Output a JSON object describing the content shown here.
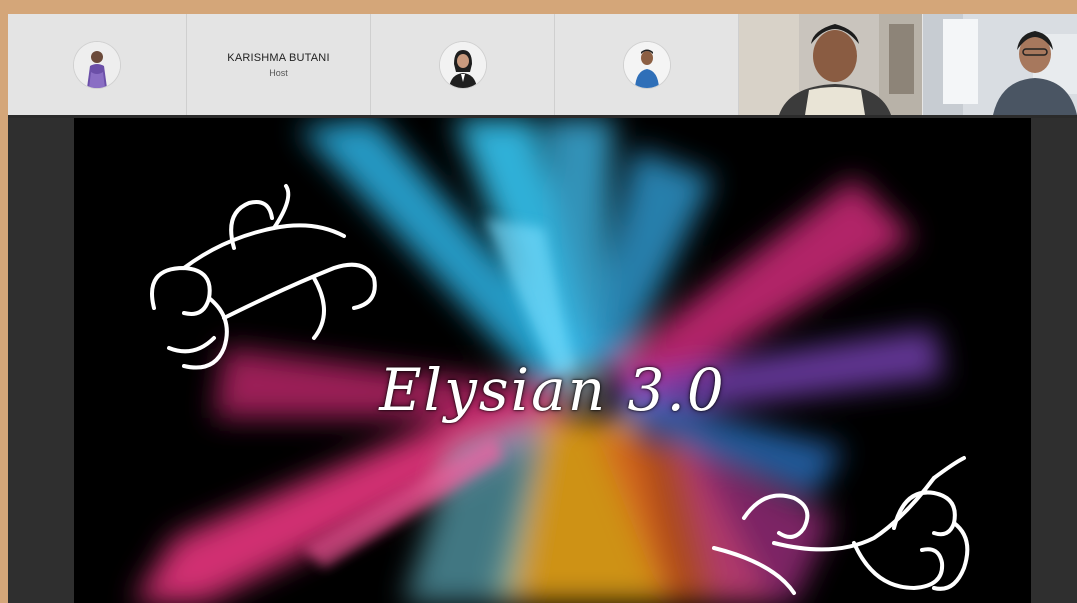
{
  "participants": [
    {
      "id": "p1",
      "has_video": false
    },
    {
      "id": "p2",
      "name": "KARISHMA BUTANI",
      "role": "Host",
      "has_video": false
    },
    {
      "id": "p3",
      "has_video": false
    },
    {
      "id": "p4",
      "has_video": false
    },
    {
      "id": "p5",
      "has_video": true
    },
    {
      "id": "p6",
      "has_video": true
    }
  ],
  "shared_screen": {
    "slide_title": "Elysian 3.0"
  },
  "colors": {
    "frame": "#d4a679",
    "strip_bg": "#e4e4e4",
    "stage_bg": "#2f2f2f",
    "slide_bg": "#000000"
  }
}
